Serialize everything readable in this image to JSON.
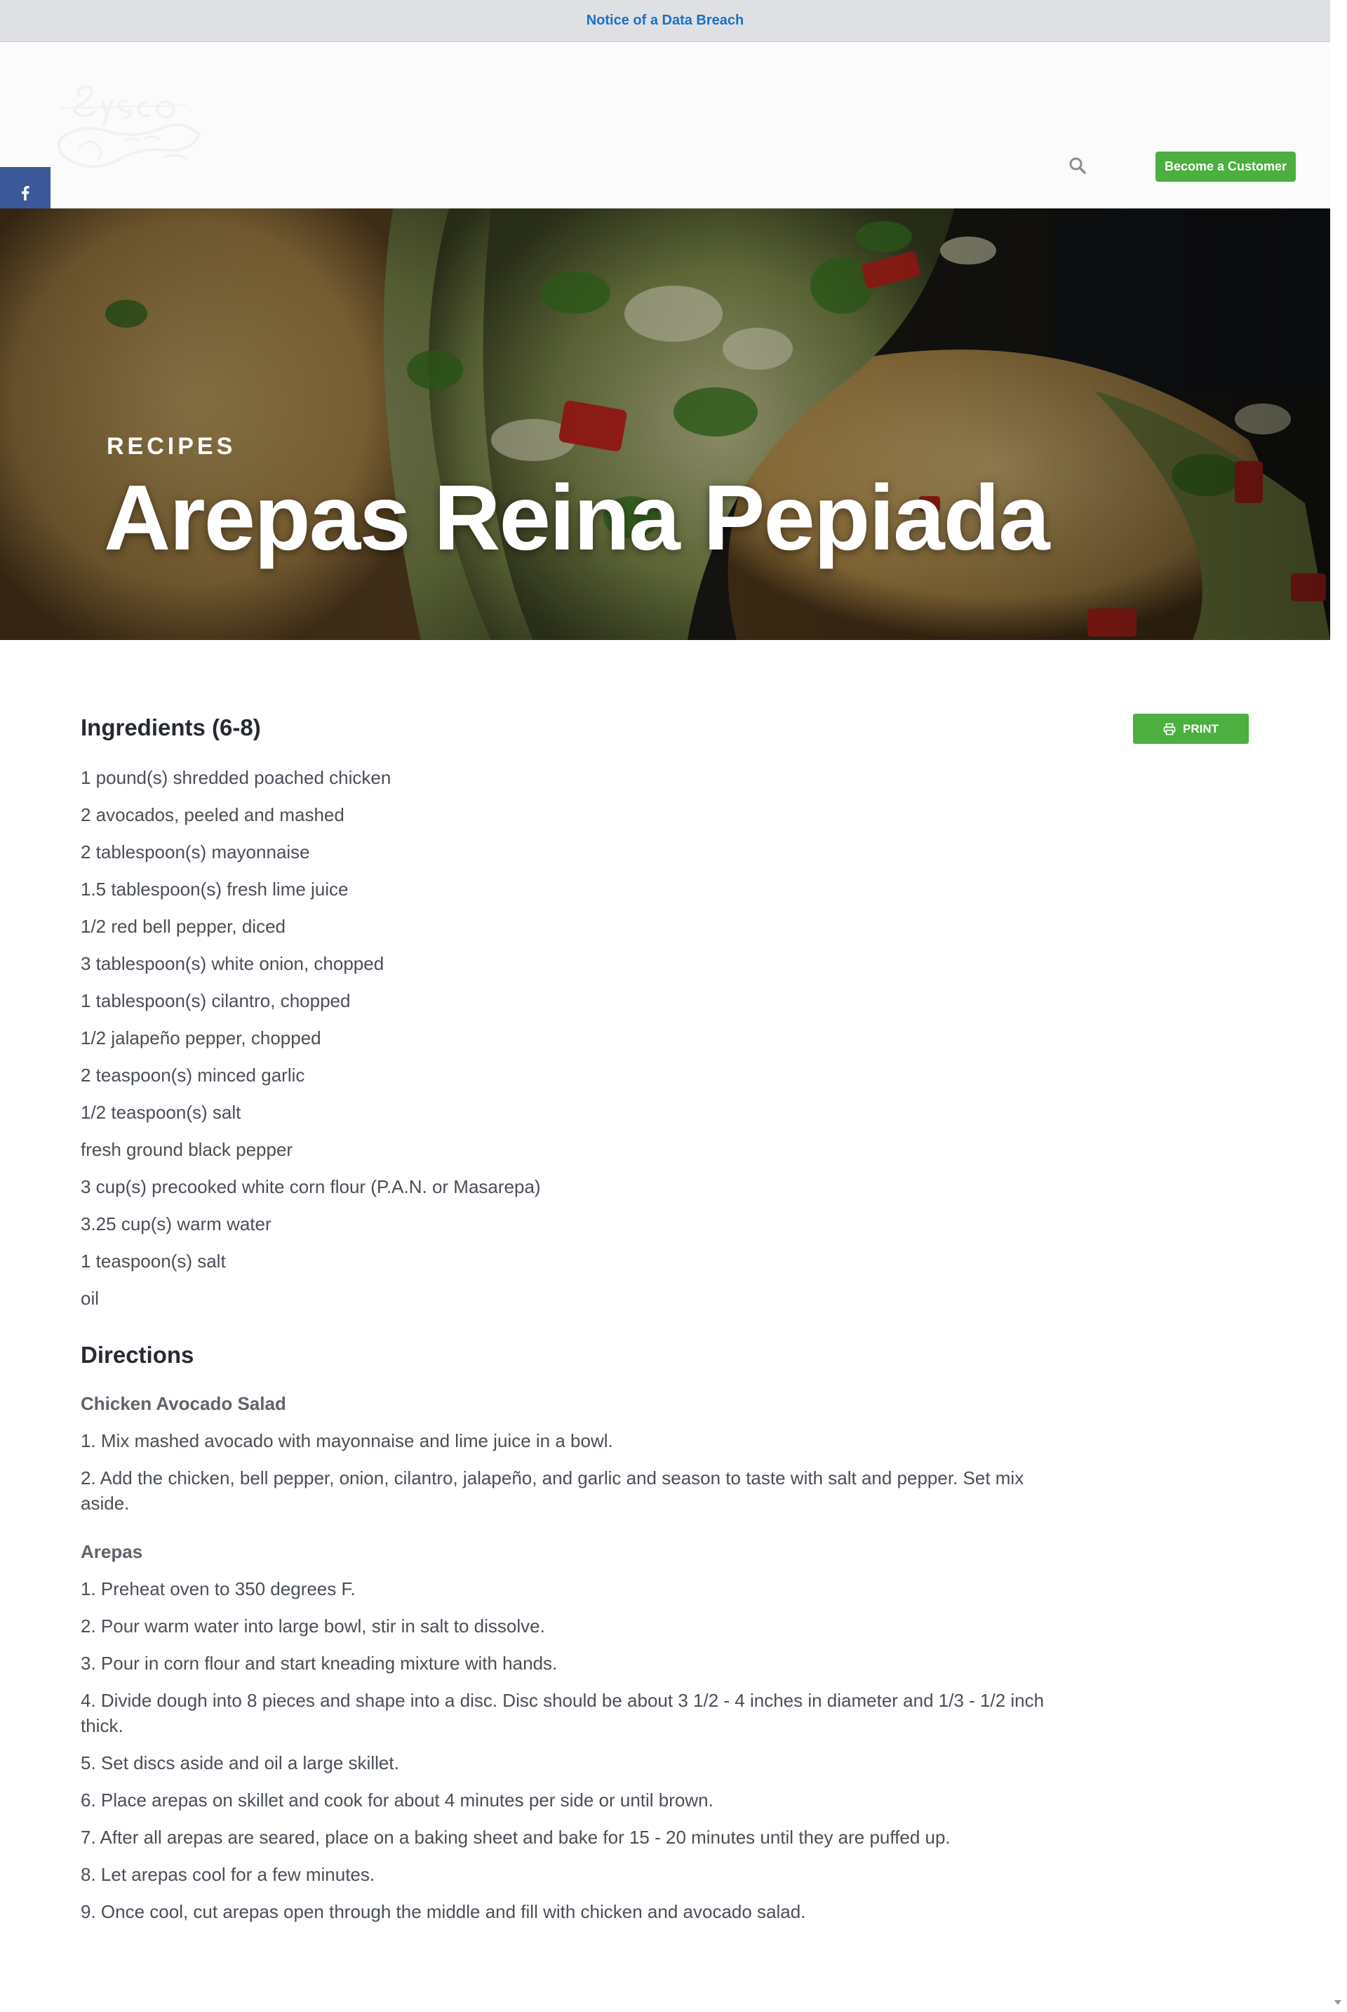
{
  "notice": {
    "link_text": "Notice of a Data Breach"
  },
  "header": {
    "logo_text": "Sysco Shipley",
    "search_icon": "search-icon",
    "cta_label": "Become a Customer",
    "accent_color": "#4caf3f"
  },
  "social": {
    "items": [
      {
        "icon": "facebook-icon",
        "color": "#3b5998"
      },
      {
        "icon": "x-icon",
        "color": "#000000"
      },
      {
        "icon": "pinterest-icon",
        "color": "#cb2027"
      },
      {
        "icon": "email-icon",
        "color": "#848484"
      },
      {
        "icon": "share-icon",
        "color": "#95d03a"
      }
    ]
  },
  "hero": {
    "eyebrow": "RECIPES",
    "title": "Arepas Reina Pepiada"
  },
  "recipe": {
    "ingredients_heading": "Ingredients (6-8)",
    "print_label": "PRINT",
    "ingredients": [
      "1 pound(s) shredded poached chicken",
      "2 avocados, peeled and mashed",
      "2 tablespoon(s) mayonnaise",
      "1.5 tablespoon(s) fresh lime juice",
      "1/2 red bell pepper, diced",
      "3 tablespoon(s) white onion, chopped",
      "1 tablespoon(s) cilantro, chopped",
      "1/2 jalapeño pepper, chopped",
      "2 teaspoon(s) minced garlic",
      "1/2 teaspoon(s) salt",
      "fresh ground black pepper",
      "3 cup(s) precooked white corn flour (P.A.N. or Masarepa)",
      "3.25 cup(s) warm water",
      "1 teaspoon(s) salt",
      "oil"
    ],
    "directions_heading": "Directions",
    "sections": [
      {
        "title": "Chicken Avocado Salad",
        "steps": [
          "1. Mix mashed avocado with mayonnaise and lime juice in a bowl.",
          "2. Add the chicken, bell pepper, onion, cilantro, jalapeño, and garlic and season to taste with salt and pepper. Set mix aside."
        ]
      },
      {
        "title": "Arepas",
        "steps": [
          "1. Preheat oven to 350 degrees F.",
          "2. Pour warm water into large bowl, stir in salt to dissolve.",
          "3. Pour in corn flour and start kneading mixture with hands.",
          "4. Divide dough into 8 pieces and shape into a disc. Disc should be about 3 1/2 - 4 inches in diameter and 1/3 - 1/2 inch thick.",
          "5. Set discs aside and oil a large skillet.",
          "6. Place arepas on skillet and cook for about 4 minutes per side or until brown.",
          "7. After all arepas are seared, place on a baking sheet and bake for 15 - 20 minutes until they are puffed up.",
          "8. Let arepas cool for a few minutes.",
          "9. Once cool, cut arepas open through the middle and fill with chicken and avocado salad."
        ]
      }
    ]
  }
}
